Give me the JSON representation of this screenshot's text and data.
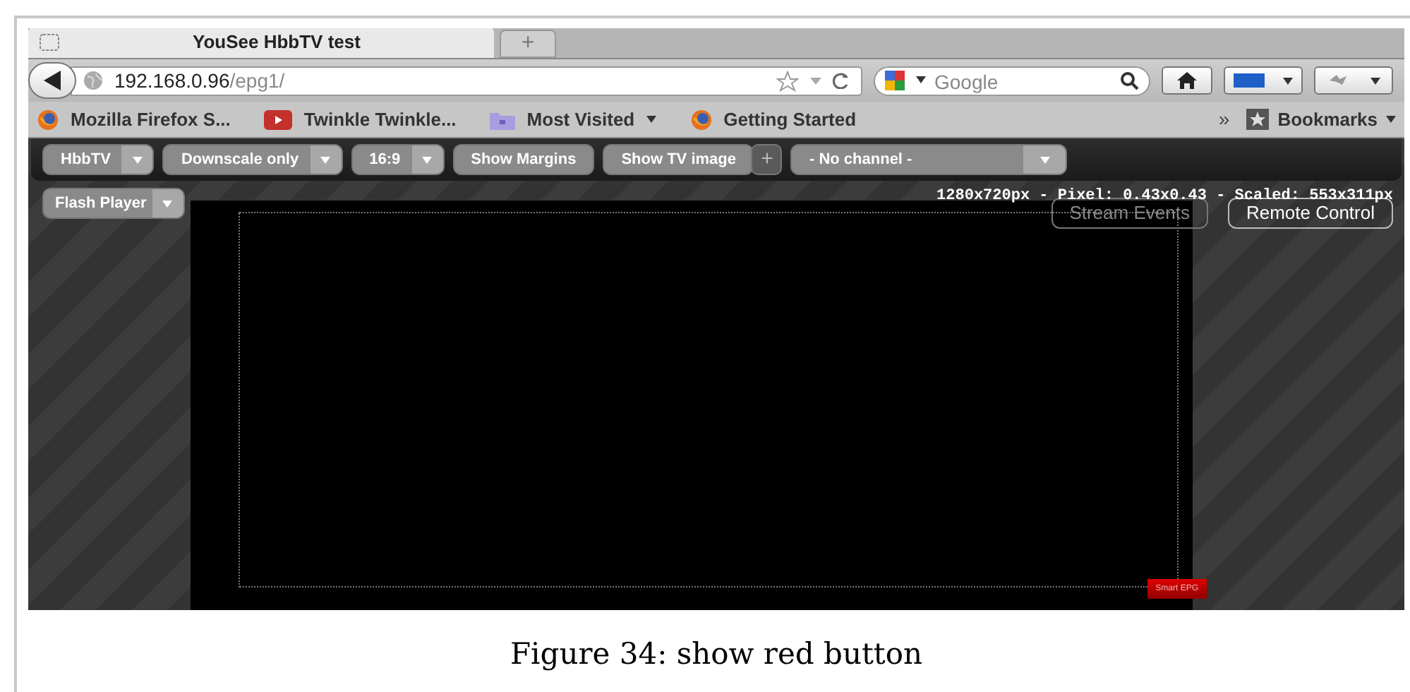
{
  "browser": {
    "tab": {
      "title": "YouSee HbbTV test"
    },
    "new_tab": "+",
    "address": {
      "host": "192.168.0.96",
      "path": "/epg1/"
    },
    "search": {
      "placeholder": "Google"
    },
    "bookmarks": [
      {
        "label": "Mozilla Firefox S...",
        "kind": "firefox",
        "dropdown": false
      },
      {
        "label": "Twinkle Twinkle...",
        "kind": "video",
        "dropdown": false
      },
      {
        "label": "Most Visited",
        "kind": "folder",
        "dropdown": true
      },
      {
        "label": "Getting Started",
        "kind": "firefox",
        "dropdown": false
      }
    ],
    "overflow": "»",
    "bookmarks_menu": "Bookmarks"
  },
  "app": {
    "toolbar": [
      {
        "label": "HbbTV",
        "kind": "dropdown"
      },
      {
        "label": "Downscale only",
        "kind": "dropdown"
      },
      {
        "label": "16:9",
        "kind": "dropdown"
      },
      {
        "label": "Show Margins",
        "kind": "button"
      },
      {
        "label": "Show TV image",
        "kind": "button"
      },
      {
        "label": "+",
        "kind": "add"
      },
      {
        "label": "- No channel -",
        "kind": "select"
      }
    ],
    "player": {
      "label": "Flash Player"
    },
    "info": "1280x720px - Pixel: 0.43x0.43 - Scaled: 553x311px",
    "side_buttons": [
      {
        "label": "Stream Events",
        "disabled": true
      },
      {
        "label": "Remote Control",
        "disabled": false
      }
    ],
    "red_button": "Smart EPG"
  },
  "caption": "Figure 34: show red button"
}
